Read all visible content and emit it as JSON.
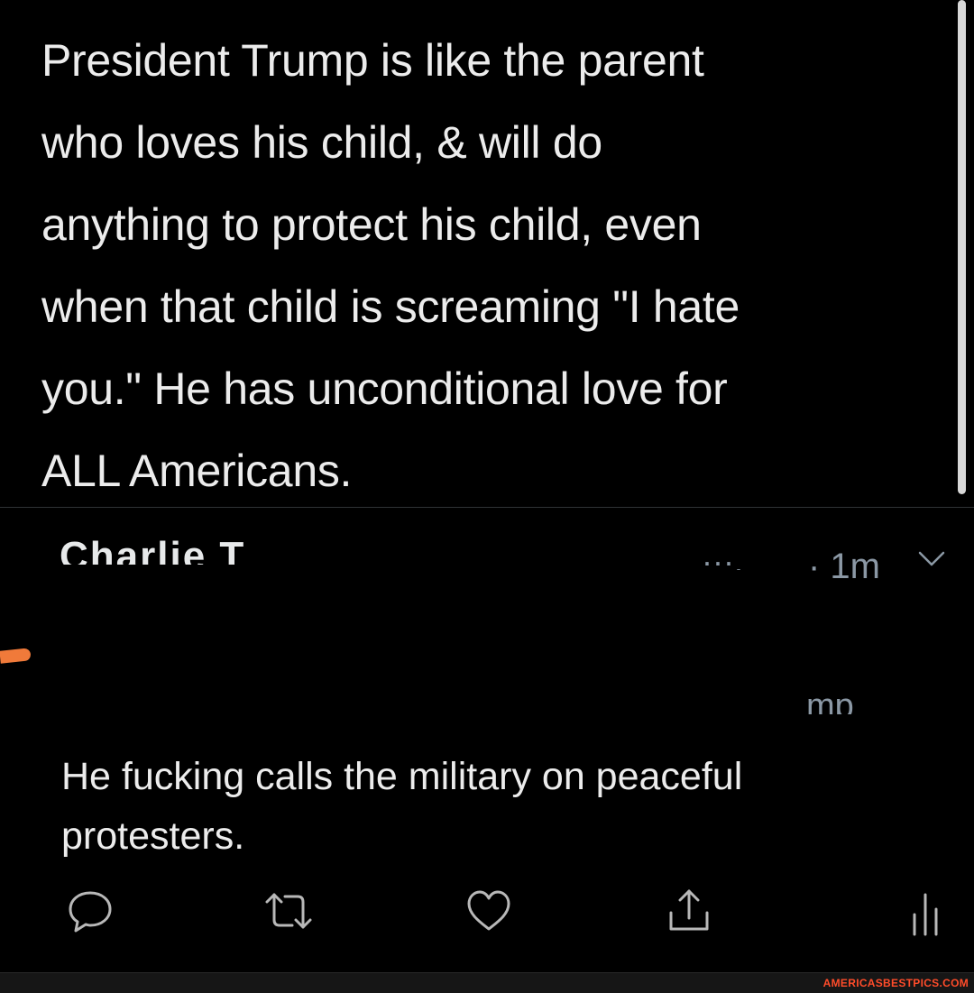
{
  "main_tweet": {
    "lines": [
      "President Trump is like the parent",
      "who loves his child, & will do",
      "anything to protect his child, even",
      "when that child is screaming \"I hate",
      "you.\" He has unconditional love for",
      "ALL Americans."
    ]
  },
  "reply": {
    "name_fragment": "Charlie T",
    "handle_fragment": "···.",
    "time": "· 1m",
    "replying_to_fragment": "mp",
    "text_lines": [
      "He fucking calls the military on peaceful",
      "protesters."
    ]
  },
  "actions": {
    "reply_icon": "reply-icon",
    "retweet_icon": "retweet-icon",
    "like_icon": "like-icon",
    "share_icon": "share-icon",
    "analytics_icon": "analytics-icon"
  },
  "watermark": "AMERICASBESTPICS.COM",
  "colors": {
    "background": "#000000",
    "text": "#ececec",
    "secondary": "#8b98a5",
    "watermark": "#ff4c2a"
  }
}
